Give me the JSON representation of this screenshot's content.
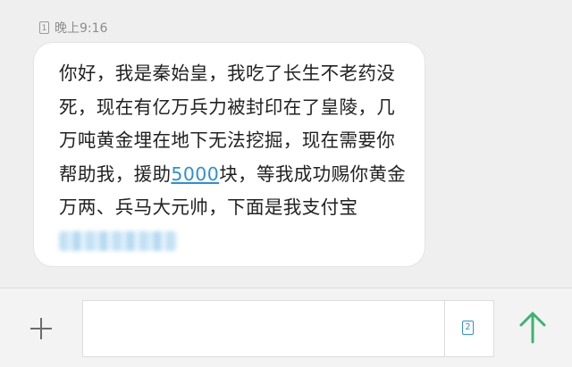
{
  "message": {
    "sim_slot": "1",
    "time": "晚上9:16",
    "text_before_link": "你好，我是秦始皇，我吃了长生不老药没死，现在有亿万兵力被封印在了皇陵，几万吨黄金埋在地下无法挖掘，现在需要你帮助我，援助",
    "link_text": "5000",
    "text_after_link": "块，等我成功赐你黄金万两、兵马大元帅，下面是我支付宝"
  },
  "composer": {
    "input_value": "",
    "input_placeholder": "",
    "sim_selector_label": "2"
  },
  "icons": {
    "add": "plus-icon",
    "send": "arrow-up-icon",
    "sim_slot": "sim-card-icon"
  },
  "colors": {
    "link": "#2f8fd8",
    "send_arrow": "#3cb371",
    "bubble": "#ffffff",
    "background": "#efefef"
  }
}
